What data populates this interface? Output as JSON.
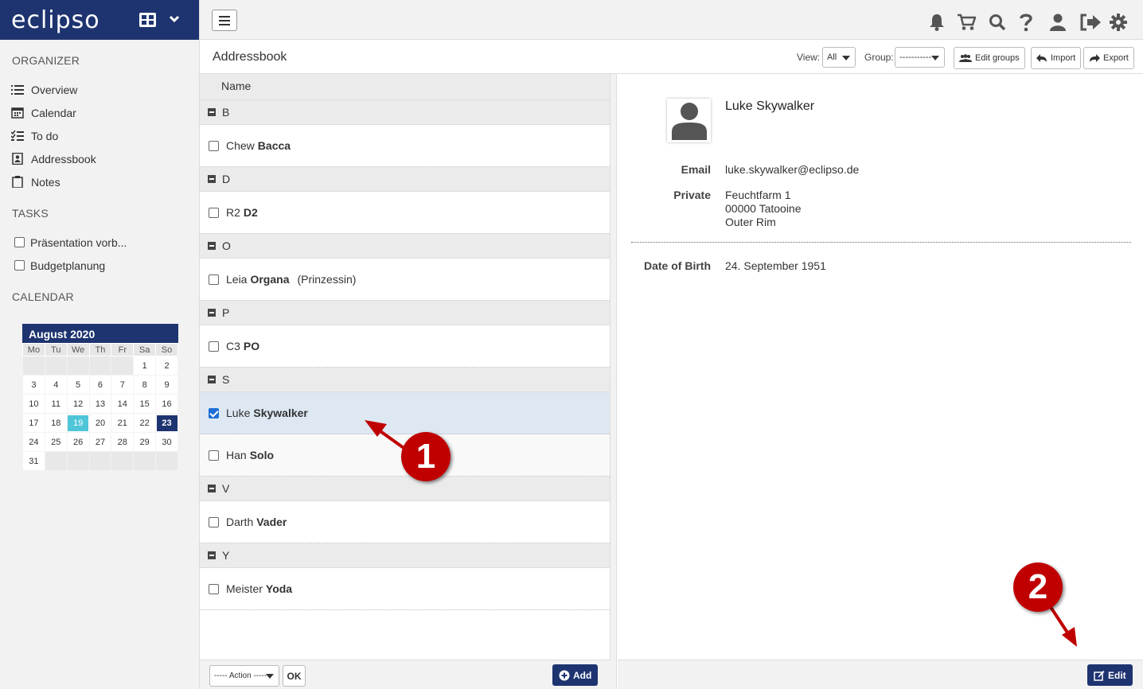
{
  "brand": {
    "logo": "eclipso"
  },
  "sidebar": {
    "organizer_title": "ORGANIZER",
    "items": [
      {
        "label": "Overview",
        "icon": "list-icon"
      },
      {
        "label": "Calendar",
        "icon": "calendar-icon"
      },
      {
        "label": "To do",
        "icon": "todo-icon"
      },
      {
        "label": "Addressbook",
        "icon": "addressbook-icon"
      },
      {
        "label": "Notes",
        "icon": "clipboard-icon"
      }
    ],
    "tasks_title": "TASKS",
    "tasks": [
      {
        "label": "Präsentation vorb..."
      },
      {
        "label": "Budgetplanung"
      }
    ],
    "calendar_title": "CALENDAR"
  },
  "calendar": {
    "month": "August 2020",
    "weekdays": [
      "Mo",
      "Tu",
      "We",
      "Th",
      "Fr",
      "Sa",
      "So"
    ],
    "weeks": [
      [
        "",
        "",
        "",
        "",
        "",
        "1",
        "2"
      ],
      [
        "3",
        "4",
        "5",
        "6",
        "7",
        "8",
        "9"
      ],
      [
        "10",
        "11",
        "12",
        "13",
        "14",
        "15",
        "16"
      ],
      [
        "17",
        "18",
        "19",
        "20",
        "21",
        "22",
        "23"
      ],
      [
        "24",
        "25",
        "26",
        "27",
        "28",
        "29",
        "30"
      ],
      [
        "31",
        "",
        "",
        "",
        "",
        "",
        ""
      ]
    ],
    "today": "19",
    "selected": "23"
  },
  "header": {
    "title": "Addressbook",
    "view_label": "View:",
    "view_value": "All",
    "group_label": "Group:",
    "group_value": "-----------",
    "edit_groups": "Edit groups",
    "import": "Import",
    "export": "Export"
  },
  "list": {
    "column_name": "Name",
    "groups": [
      {
        "letter": "B",
        "contacts": [
          {
            "first": "Chew",
            "last": "Bacca",
            "extra": "",
            "checked": false
          }
        ]
      },
      {
        "letter": "D",
        "contacts": [
          {
            "first": "R2",
            "last": "D2",
            "extra": "",
            "checked": false
          }
        ]
      },
      {
        "letter": "O",
        "contacts": [
          {
            "first": "Leia",
            "last": "Organa",
            "extra": "(Prinzessin)",
            "checked": false
          }
        ]
      },
      {
        "letter": "P",
        "contacts": [
          {
            "first": "C3",
            "last": "PO",
            "extra": "",
            "checked": false
          }
        ]
      },
      {
        "letter": "S",
        "contacts": [
          {
            "first": "Luke",
            "last": "Skywalker",
            "extra": "",
            "checked": true
          },
          {
            "first": "Han",
            "last": "Solo",
            "extra": "",
            "checked": false
          }
        ]
      },
      {
        "letter": "V",
        "contacts": [
          {
            "first": "Darth",
            "last": "Vader",
            "extra": "",
            "checked": false
          }
        ]
      },
      {
        "letter": "Y",
        "contacts": [
          {
            "first": "Meister",
            "last": "Yoda",
            "extra": "",
            "checked": false
          }
        ]
      }
    ],
    "action_select": "----- Action -----",
    "ok": "OK",
    "add": "Add"
  },
  "detail": {
    "name": "Luke Skywalker",
    "email_label": "Email",
    "email": "luke.skywalker@eclipso.de",
    "private_label": "Private",
    "address_line1": "Feuchtfarm 1",
    "address_line2": "00000 Tatooine",
    "address_line3": "Outer Rim",
    "dob_label": "Date of Birth",
    "dob": "24. September 1951",
    "edit": "Edit"
  },
  "annotations": {
    "one": "1",
    "two": "2"
  },
  "colors": {
    "brand": "#1e3470",
    "today": "#4fc6d8",
    "selected_row": "#dde8f3",
    "annotation": "#c00000"
  }
}
